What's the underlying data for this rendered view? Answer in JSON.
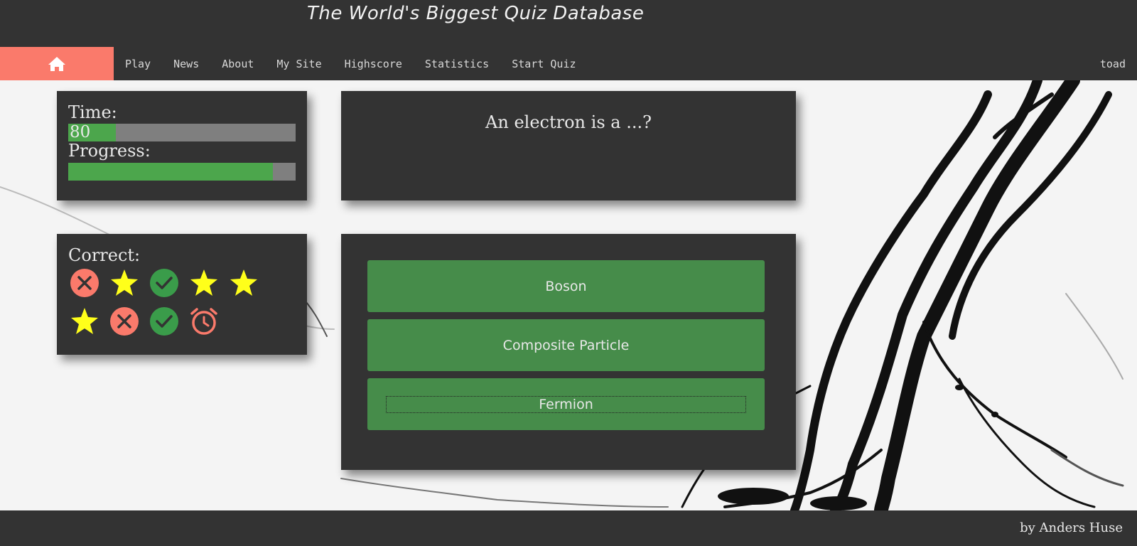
{
  "header": {
    "site_title": "The World's Biggest Quiz Database",
    "home_icon": "home-icon",
    "nav": [
      "Play",
      "News",
      "About",
      "My Site",
      "Highscore",
      "Statistics",
      "Start Quiz"
    ],
    "user": "toad"
  },
  "status": {
    "time_label": "Time:",
    "time_value": "80",
    "time_fraction": 0.21,
    "progress_label": "Progress:",
    "progress_fraction": 0.9
  },
  "question": {
    "text": "An electron is a ...?"
  },
  "correct": {
    "label": "Correct:",
    "results": [
      "wrong",
      "star",
      "correct",
      "star",
      "star",
      "star",
      "wrong",
      "correct",
      "timeout"
    ]
  },
  "answers": [
    "Boson",
    "Composite Particle",
    "Fermion"
  ],
  "footer": {
    "credit": "by Anders Huse"
  },
  "colors": {
    "accent": "#fa7a6b",
    "panel": "#333333",
    "answer_bg": "#468c4a",
    "bar_fill": "#4ca64c",
    "star": "#ffff1a",
    "correct": "#3a9c4a"
  }
}
